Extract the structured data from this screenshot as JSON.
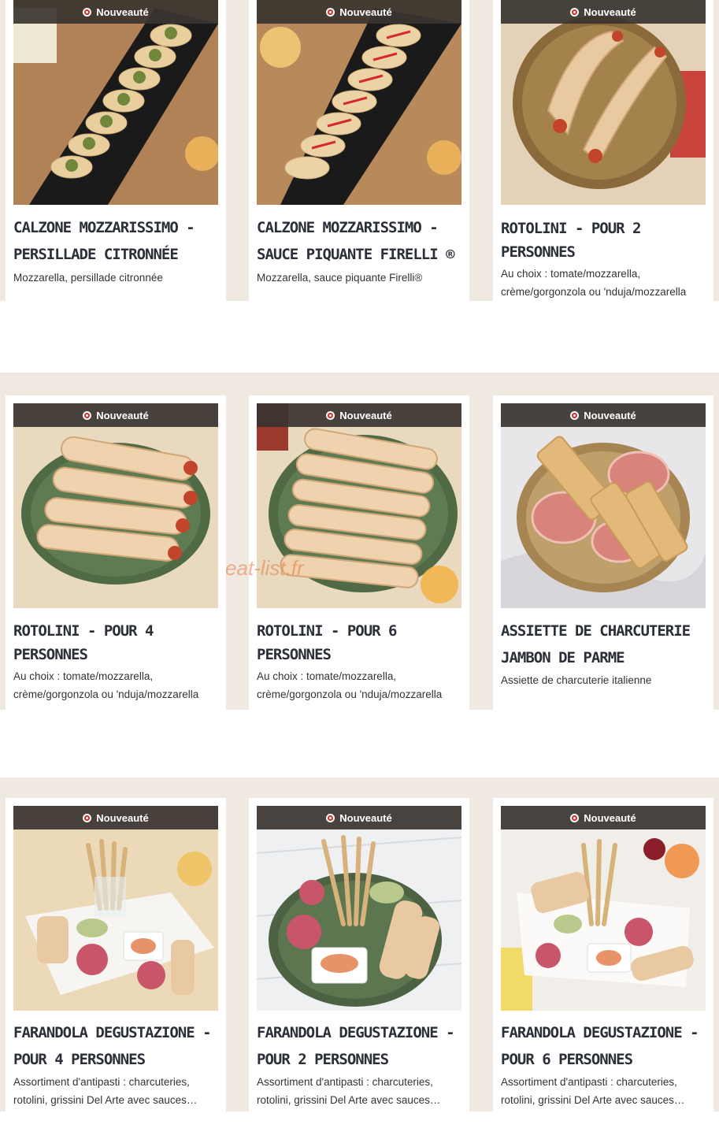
{
  "badge_label": "Nouveauté",
  "watermark": "eat-list.fr",
  "colors": {
    "band": "#efe9e1",
    "badge_bg": "#3a3430",
    "title": "#2b2f38",
    "flag_red": "#c9302c"
  },
  "rows": [
    {
      "cards": [
        {
          "title": "Calzone Mozzarissimo - Persillade citronnée",
          "desc": "Mozzarella, persillade citronnée",
          "image": "calzone-persillade-image"
        },
        {
          "title": "Calzone Mozzarissimo - Sauce piquante Firelli ®",
          "desc": "Mozzarella, sauce piquante Firelli®",
          "image": "calzone-firelli-image"
        },
        {
          "title": "Rotolini - pour 2 personnes",
          "desc": "Au choix : tomate/mozzarella, crème/gorgonzola ou 'nduja/mozzarella",
          "image": "rotolini-2-image"
        }
      ]
    },
    {
      "cards": [
        {
          "title": "Rotolini - pour 4 personnes",
          "desc": "Au choix : tomate/mozzarella, crème/gorgonzola ou 'nduja/mozzarella",
          "image": "rotolini-4-image"
        },
        {
          "title": "Rotolini - pour 6 personnes",
          "desc": "Au choix : tomate/mozzarella, crème/gorgonzola ou 'nduja/mozzarella",
          "image": "rotolini-6-image"
        },
        {
          "title": "Assiette de charcuterie Jambon de Parme",
          "desc": "Assiette de charcuterie italienne",
          "image": "charcuterie-image"
        }
      ]
    },
    {
      "cards": [
        {
          "title": "Farandola Degustazione - pour 4 personnes",
          "desc": "Assortiment d'antipasti : charcuteries, rotolini, grissini Del Arte avec sauces…",
          "image": "farandola-4-image"
        },
        {
          "title": "Farandola Degustazione - pour 2 personnes",
          "desc": "Assortiment d'antipasti : charcuteries, rotolini, grissini Del Arte avec sauces…",
          "image": "farandola-2-image"
        },
        {
          "title": "Farandola Degustazione - pour 6 personnes",
          "desc": "Assortiment d'antipasti : charcuteries, rotolini, grissini Del Arte avec sauces…",
          "image": "farandola-6-image"
        }
      ]
    }
  ]
}
